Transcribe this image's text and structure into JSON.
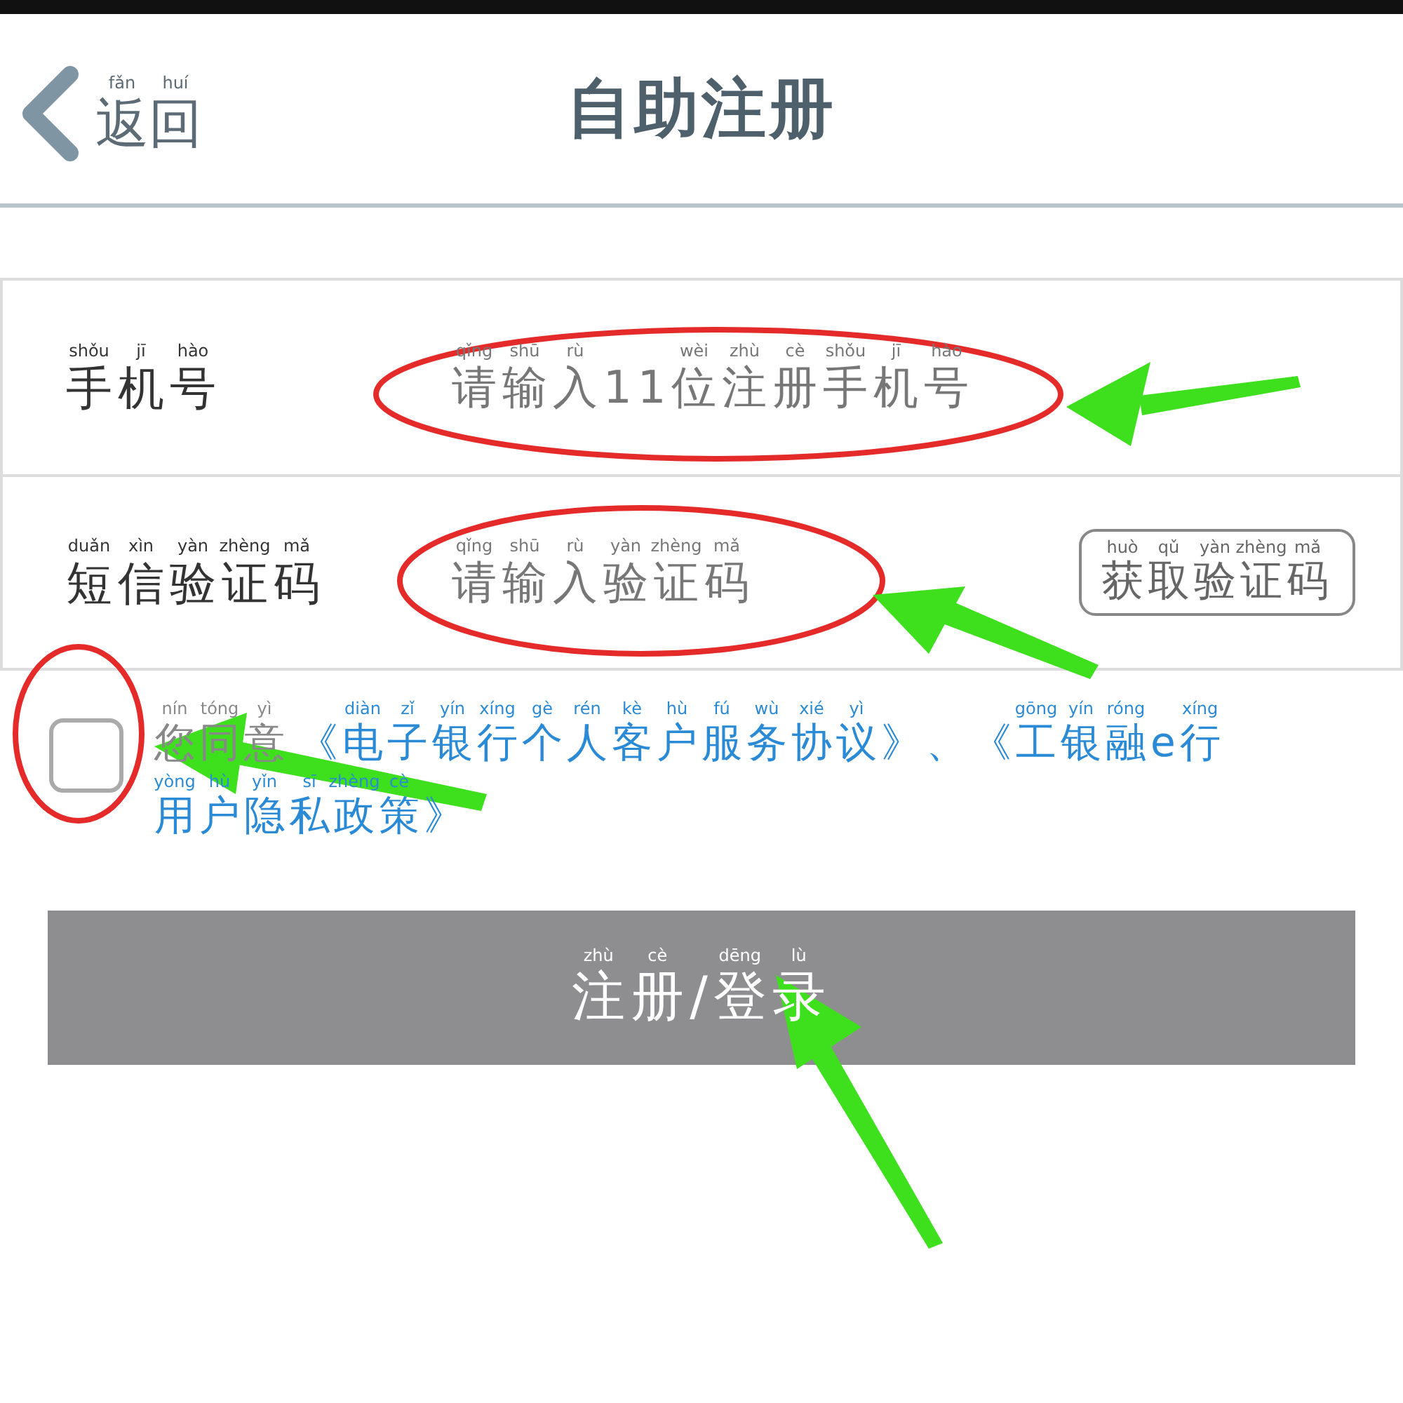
{
  "header": {
    "back": {
      "text": "返回",
      "pinyin": [
        "fǎn",
        "huí"
      ]
    },
    "title": "自助注册"
  },
  "fields": [
    {
      "label": {
        "text": "手机号",
        "pinyin": [
          "shǒu",
          "jī",
          "hào"
        ]
      },
      "placeholder": {
        "text": "请输入11位注册手机号",
        "pinyin": [
          "qǐng",
          "shū",
          "rù",
          "wèi",
          "zhù",
          "cè",
          "shǒu",
          "jī",
          "hào"
        ]
      }
    },
    {
      "label": {
        "text": "短信验证码",
        "pinyin": [
          "duǎn",
          "xìn",
          "yàn",
          "zhèng",
          "mǎ"
        ]
      },
      "placeholder": {
        "text": "请输入验证码",
        "pinyin": [
          "qǐng",
          "shū",
          "rù",
          "yàn",
          "zhèng",
          "mǎ"
        ]
      },
      "button": {
        "text": "获取验证码",
        "pinyin": [
          "huò",
          "qǔ",
          "yàn",
          "zhèng",
          "mǎ"
        ]
      }
    }
  ],
  "agreement": {
    "checked": false,
    "prefix": {
      "text": "您同意",
      "pinyin": [
        "nín",
        "tóng",
        "yì"
      ]
    },
    "link_lines": [
      {
        "text": "《电子银行个人客户服务协议》、《工银融e行",
        "pinyin": [
          "diàn",
          "zǐ",
          "yín",
          "xíng",
          "gè",
          "rén",
          "kè",
          "hù",
          "fú",
          "wù",
          "xié",
          "yì",
          "gōng",
          "yín",
          "róng",
          "xíng"
        ]
      },
      {
        "text": "用户隐私政策》",
        "pinyin": [
          "yòng",
          "hù",
          "yǐn",
          "sī",
          "zhèng",
          "cè"
        ]
      }
    ]
  },
  "submit": {
    "text": "注册/登录",
    "pinyin": [
      "zhù",
      "cè",
      "dēng",
      "lù"
    ],
    "disabled": true
  }
}
